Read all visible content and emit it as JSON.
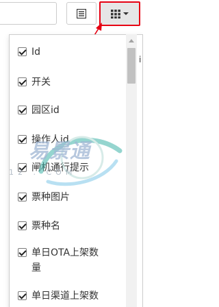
{
  "toolbar": {
    "search_value": "",
    "list_button_icon": "list-view-icon",
    "columns_button_icon": "grid-icon",
    "columns_caret_icon": "chevron-down-icon",
    "highlight_color": "#e60012"
  },
  "column_menu": {
    "items": [
      {
        "label": "Id",
        "checked": true
      },
      {
        "label": "开关",
        "checked": true
      },
      {
        "label": "园区id",
        "checked": true
      },
      {
        "label": "操作人id",
        "checked": true
      },
      {
        "label": "闸机通行提示",
        "checked": true
      },
      {
        "label": "票种图片",
        "checked": true
      },
      {
        "label": "票种名",
        "checked": true
      },
      {
        "label": "单日OTA上架数量",
        "checked": true
      },
      {
        "label": "单日渠道上架数",
        "checked": true
      }
    ]
  },
  "edge_text": "i",
  "watermark": {
    "text": "易景通",
    "domain": "12 . COM"
  }
}
